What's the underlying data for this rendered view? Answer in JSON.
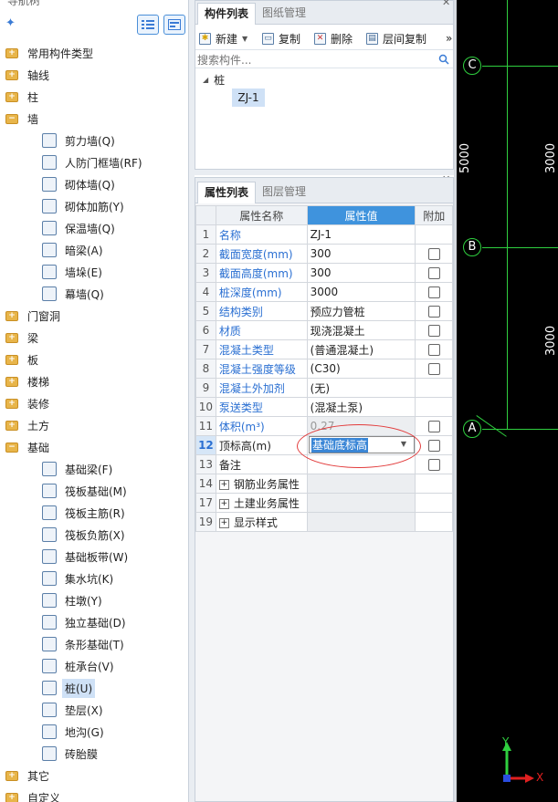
{
  "nav": {
    "title": "导航树",
    "categories": [
      {
        "label": "常用构件类型"
      },
      {
        "label": "轴线"
      },
      {
        "label": "柱"
      },
      {
        "label": "墙"
      },
      {
        "label": "门窗洞"
      },
      {
        "label": "梁"
      },
      {
        "label": "板"
      },
      {
        "label": "楼梯"
      },
      {
        "label": "装修"
      },
      {
        "label": "土方"
      },
      {
        "label": "基础"
      },
      {
        "label": "其它"
      },
      {
        "label": "自定义"
      }
    ],
    "wall_items": [
      "剪力墙(Q)",
      "人防门框墙(RF)",
      "砌体墙(Q)",
      "砌体加筋(Y)",
      "保温墙(Q)",
      "暗梁(A)",
      "墙垛(E)",
      "幕墙(Q)"
    ],
    "foundation_items": [
      "基础梁(F)",
      "筏板基础(M)",
      "筏板主筋(R)",
      "筏板负筋(X)",
      "基础板带(W)",
      "集水坑(K)",
      "柱墩(Y)",
      "独立基础(D)",
      "条形基础(T)",
      "桩承台(V)",
      "桩(U)",
      "垫层(X)",
      "地沟(G)",
      "砖胎膜"
    ],
    "selected_item": "桩(U)"
  },
  "component_panel": {
    "tabs": [
      "构件列表",
      "图纸管理"
    ],
    "tools": [
      "新建",
      "复制",
      "删除",
      "层间复制"
    ],
    "more": "»",
    "search_placeholder": "搜索构件...",
    "tree_root": "桩",
    "tree_child": "ZJ-1"
  },
  "property_panel": {
    "tabs": [
      "属性列表",
      "图层管理"
    ],
    "headers": [
      "属性名称",
      "属性值",
      "附加"
    ],
    "rows": [
      {
        "num": "1",
        "name": "名称",
        "value": "ZJ-1",
        "blue": true,
        "check": false
      },
      {
        "num": "2",
        "name": "截面宽度(mm)",
        "value": "300",
        "blue": true,
        "check": true
      },
      {
        "num": "3",
        "name": "截面高度(mm)",
        "value": "300",
        "blue": true,
        "check": true
      },
      {
        "num": "4",
        "name": "桩深度(mm)",
        "value": "3000",
        "blue": true,
        "check": true
      },
      {
        "num": "5",
        "name": "结构类别",
        "value": "预应力管桩",
        "blue": true,
        "check": true
      },
      {
        "num": "6",
        "name": "材质",
        "value": "现浇混凝土",
        "blue": true,
        "check": true
      },
      {
        "num": "7",
        "name": "混凝土类型",
        "value": "(普通混凝土)",
        "blue": true,
        "check": true
      },
      {
        "num": "8",
        "name": "混凝土强度等级",
        "value": "(C30)",
        "blue": true,
        "check": true
      },
      {
        "num": "9",
        "name": "混凝土外加剂",
        "value": "(无)",
        "blue": true,
        "check": false
      },
      {
        "num": "10",
        "name": "泵送类型",
        "value": "(混凝土泵)",
        "blue": true,
        "check": false
      },
      {
        "num": "11",
        "name": "体积(m³)",
        "value": "0.27",
        "blue": true,
        "check": true,
        "grey": true
      },
      {
        "num": "12",
        "name": "顶标高(m)",
        "value": "",
        "blue": false,
        "check": true,
        "selected": true
      },
      {
        "num": "13",
        "name": "备注",
        "value": "",
        "blue": false,
        "check": true
      }
    ],
    "groups": [
      {
        "num": "14",
        "name": "钢筋业务属性"
      },
      {
        "num": "17",
        "name": "土建业务属性"
      },
      {
        "num": "19",
        "name": "显示样式"
      }
    ],
    "dropdown_value": "基础底标高"
  },
  "cad": {
    "axes": [
      "C",
      "B",
      "A"
    ],
    "dims": [
      "5000",
      "3000",
      "3000"
    ],
    "ucs_y": "Y",
    "ucs_x": "X",
    "grid_color": "#2fcf3f"
  }
}
